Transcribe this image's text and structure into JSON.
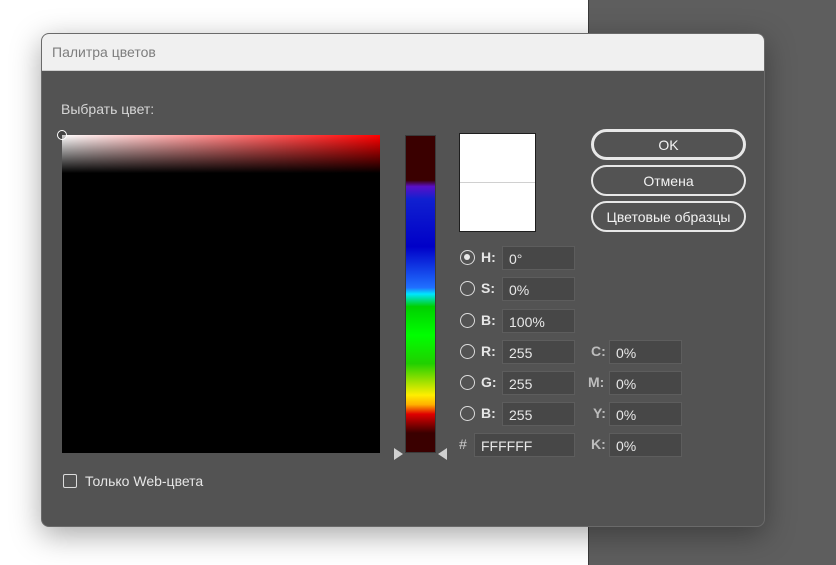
{
  "dialog": {
    "title": "Палитра цветов",
    "choose_label": "Выбрать цвет:",
    "buttons": {
      "ok": "OK",
      "cancel": "Отмена",
      "swatches": "Цветовые образцы"
    },
    "selected_mode": "H",
    "hsb": [
      {
        "label": "H:",
        "value": "0°"
      },
      {
        "label": "S:",
        "value": "0%"
      },
      {
        "label": "B:",
        "value": "100%"
      }
    ],
    "rgb": [
      {
        "label": "R:",
        "value": "255"
      },
      {
        "label": "G:",
        "value": "255"
      },
      {
        "label": "B:",
        "value": "255"
      }
    ],
    "hex": {
      "label": "#",
      "value": "FFFFFF"
    },
    "cmyk": [
      {
        "label": "C:",
        "value": "0%"
      },
      {
        "label": "M:",
        "value": "0%"
      },
      {
        "label": "Y:",
        "value": "0%"
      },
      {
        "label": "K:",
        "value": "0%"
      }
    ],
    "web_only_label": "Только Web-цвета",
    "web_only_checked": false,
    "current_color": "#ffffff",
    "previous_color": "#ffffff",
    "hue_base_color": "#ff0000"
  }
}
